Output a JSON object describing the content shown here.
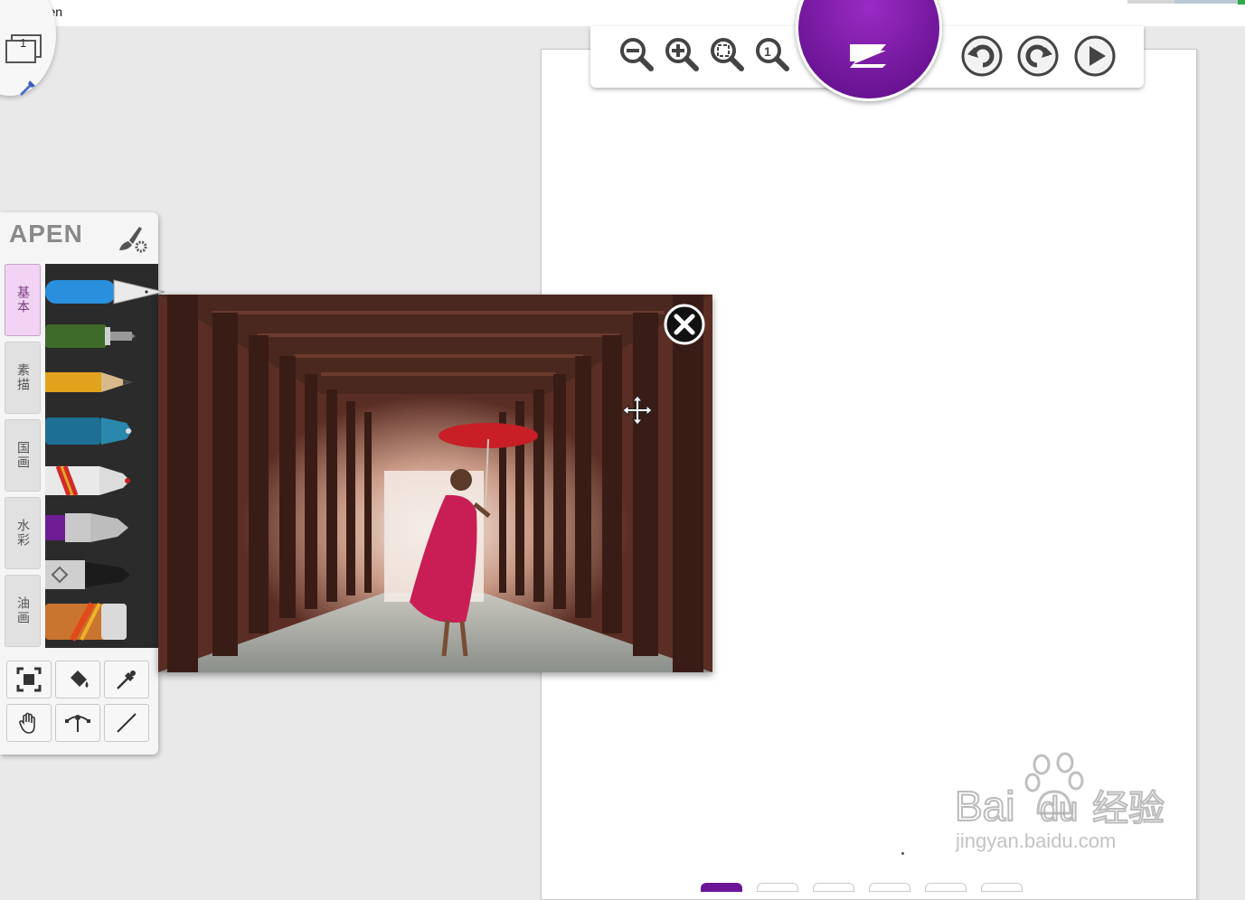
{
  "window": {
    "title": "AirPen"
  },
  "page_selector": {
    "current_page": "1"
  },
  "panel": {
    "brand": "APEN",
    "tabs": [
      {
        "label": "基本",
        "active": true
      },
      {
        "label": "素描",
        "active": false
      },
      {
        "label": "国画",
        "active": false
      },
      {
        "label": "水彩",
        "active": false
      },
      {
        "label": "油画",
        "active": false
      }
    ],
    "pens": [
      "fountain-pen",
      "green-marker",
      "pencil",
      "blue-marker",
      "red-brush",
      "purple-brush",
      "black-marker",
      "oil-brush"
    ],
    "tools": [
      "fit-screen-icon",
      "fill-bucket-icon",
      "eyedropper-icon",
      "hand-icon",
      "bezier-icon",
      "line-icon"
    ]
  },
  "toolbar": {
    "buttons": [
      "zoom-out-icon",
      "zoom-in-icon",
      "zoom-fit-icon",
      "zoom-actual-icon",
      "z-logo",
      "undo-icon",
      "redo-icon",
      "play-icon"
    ]
  },
  "watermark": {
    "logo": "Bai du 经验",
    "url": "jingyan.baidu.com"
  },
  "colors": {
    "accent": "#6d1597",
    "tab_active": "#f1d3f3"
  }
}
